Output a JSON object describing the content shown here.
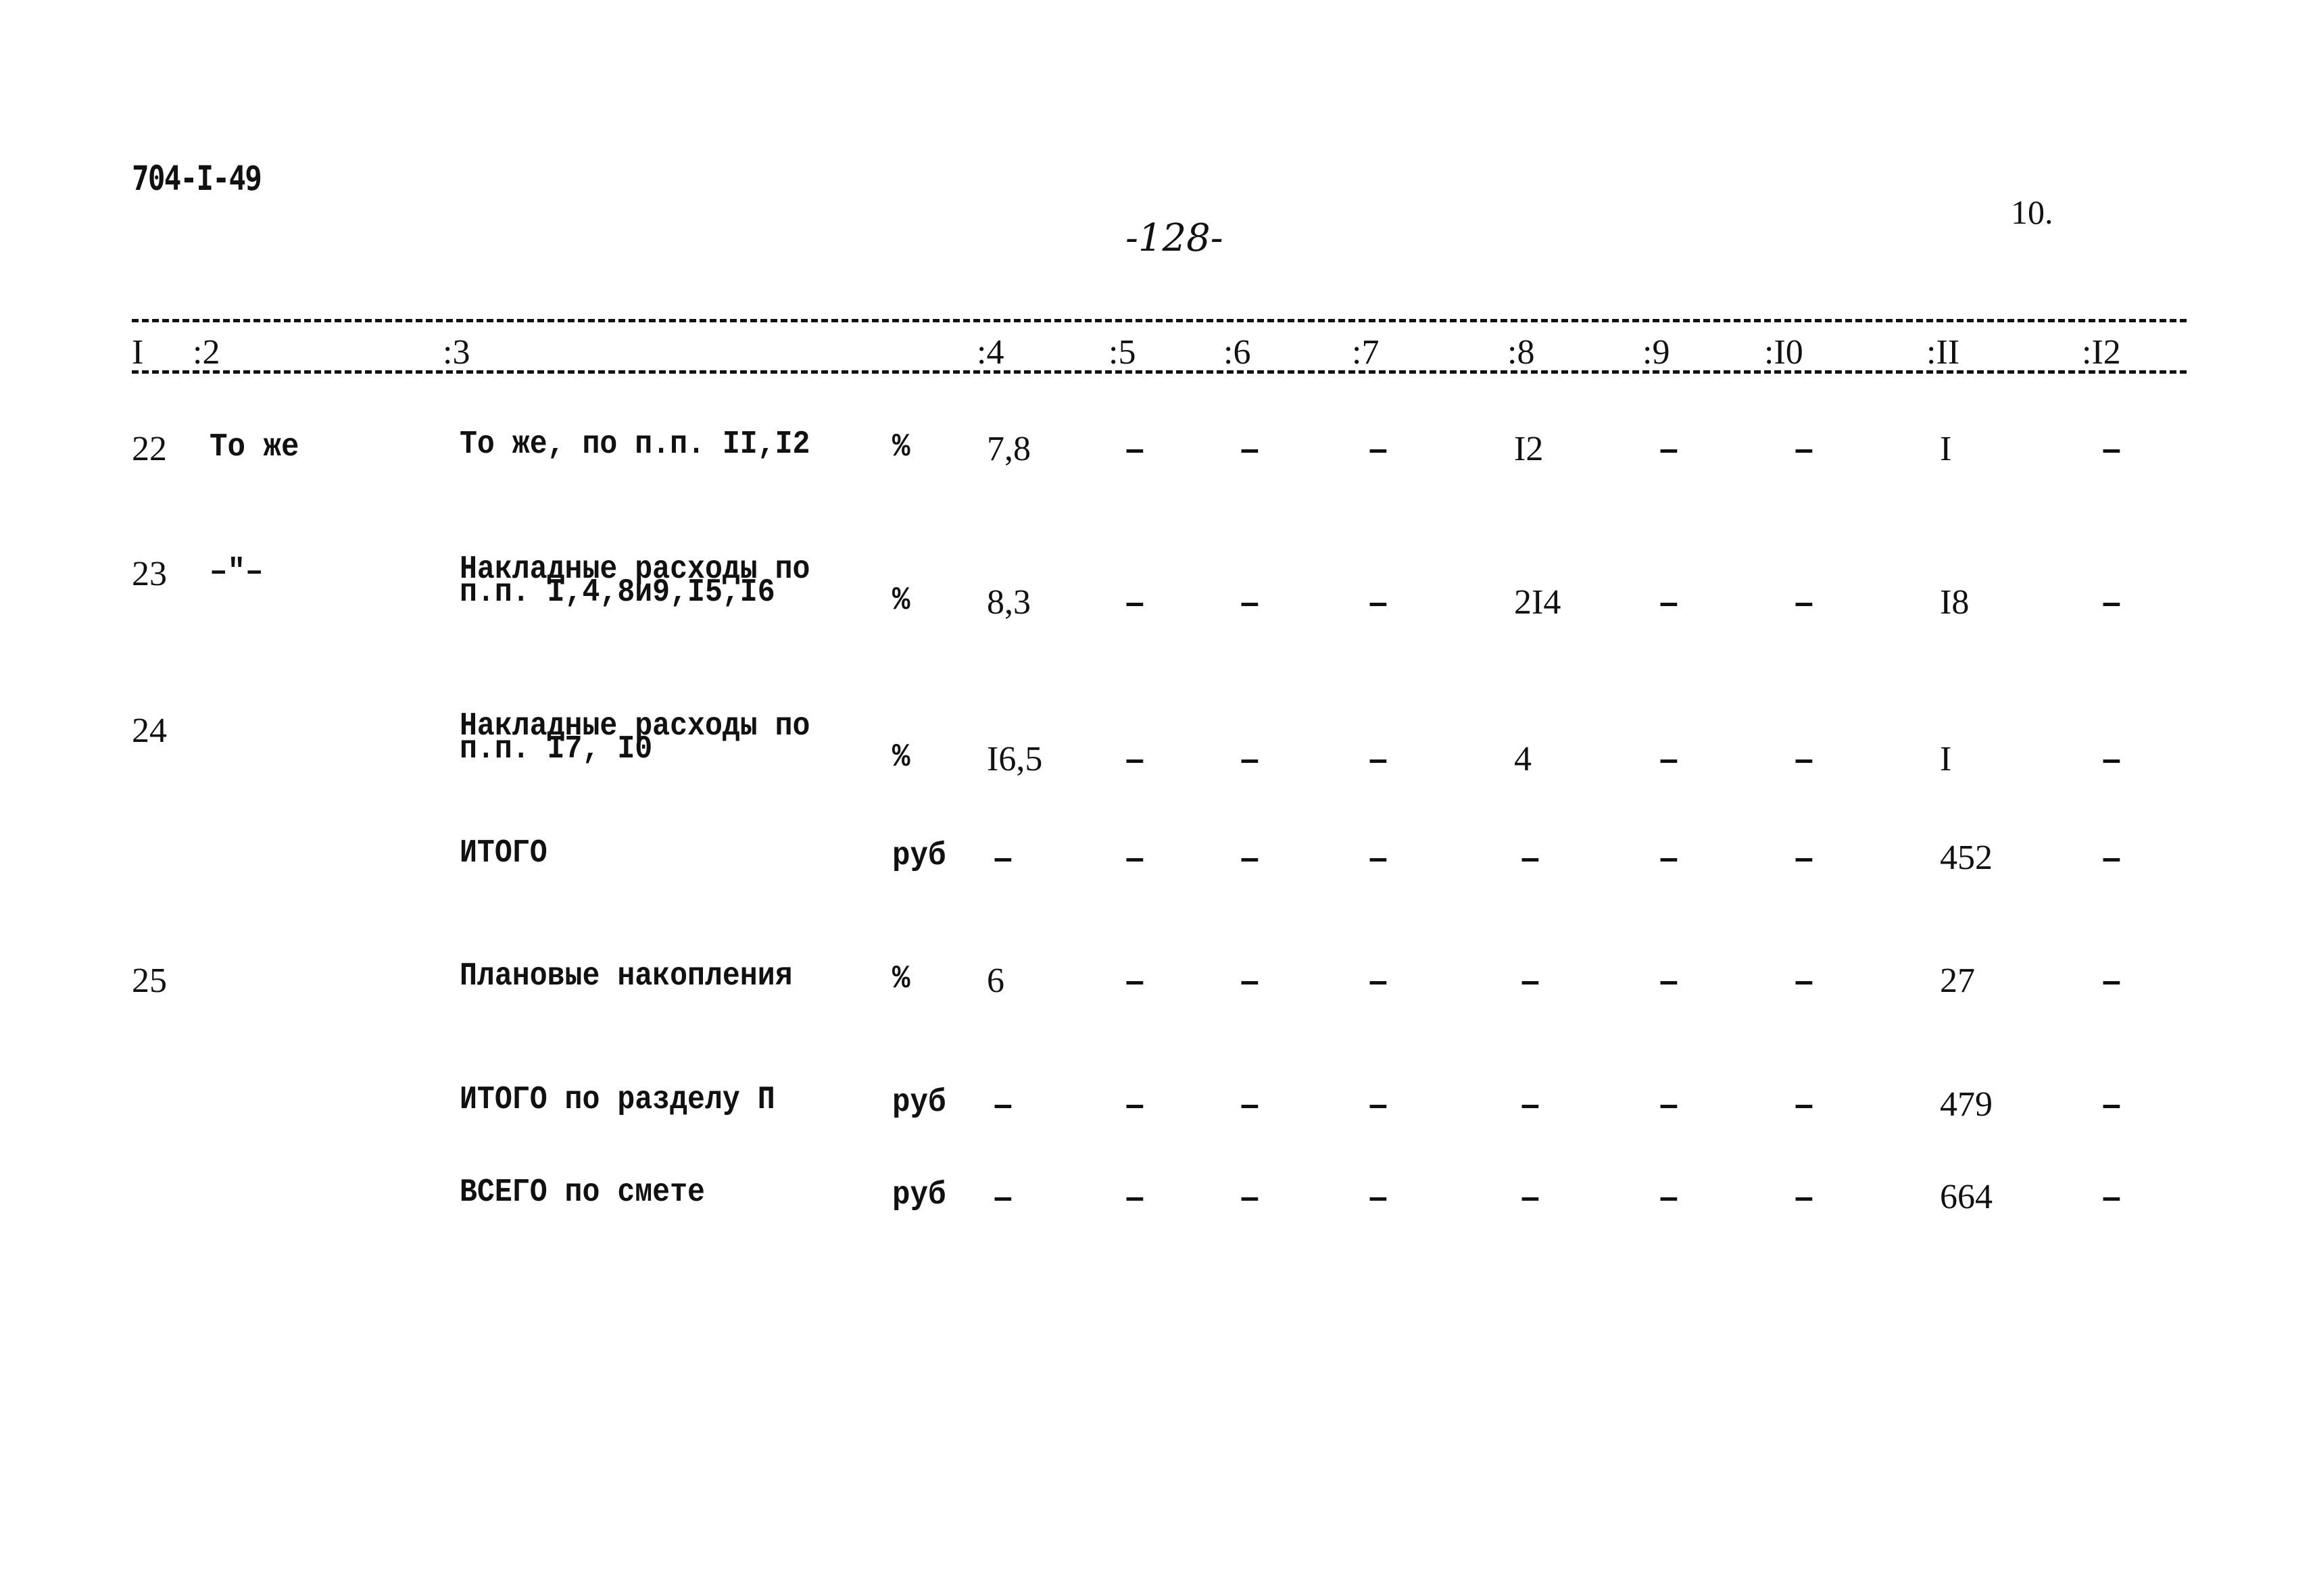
{
  "header": {
    "doc_code": "704-I-49",
    "page_number": "-128-",
    "sheet_number": "10."
  },
  "columns": [
    "I",
    ":2",
    ":3",
    ":4",
    ":5",
    ":6",
    ":7",
    ":8",
    ":9",
    ":I0",
    ":II",
    ":I2"
  ],
  "rows": [
    {
      "no": "22",
      "ref": "То же",
      "description": [
        "То же, по п.п. II,I2"
      ],
      "unit": "%",
      "values": [
        "7,8",
        "–",
        "–",
        "–",
        "I2",
        "–",
        "–",
        "I",
        "–"
      ]
    },
    {
      "no": "23",
      "ref": "–\"–",
      "description": [
        "Накладные расходы по",
        "п.п. I,4,8и9,I5,I6"
      ],
      "unit": "%",
      "values": [
        "8,3",
        "–",
        "–",
        "–",
        "2I4",
        "–",
        "–",
        "I8",
        "–"
      ]
    },
    {
      "no": "24",
      "ref": "",
      "description": [
        "Накладные расходы по",
        "п.п. I7, I0"
      ],
      "unit": "%",
      "values": [
        "I6,5",
        "–",
        "–",
        "–",
        "4",
        "–",
        "–",
        "I",
        "–"
      ]
    },
    {
      "no": "",
      "ref": "",
      "description": [
        "ИТОГО"
      ],
      "unit": "руб",
      "values": [
        "–",
        "–",
        "–",
        "–",
        "–",
        "–",
        "–",
        "452",
        "–"
      ]
    },
    {
      "no": "25",
      "ref": "",
      "description": [
        "Плановые накопления"
      ],
      "unit": "%",
      "values": [
        "6",
        "–",
        "–",
        "–",
        "–",
        "–",
        "–",
        "27",
        "–"
      ]
    },
    {
      "no": "",
      "ref": "",
      "description": [
        "ИТОГО по разделу П"
      ],
      "unit": "руб",
      "values": [
        "–",
        "–",
        "–",
        "–",
        "–",
        "–",
        "–",
        "479",
        "–"
      ]
    },
    {
      "no": "",
      "ref": "",
      "description": [
        "ВСЕГО по смете"
      ],
      "unit": "руб",
      "values": [
        "–",
        "–",
        "–",
        "–",
        "–",
        "–",
        "–",
        "664",
        "–"
      ]
    }
  ]
}
